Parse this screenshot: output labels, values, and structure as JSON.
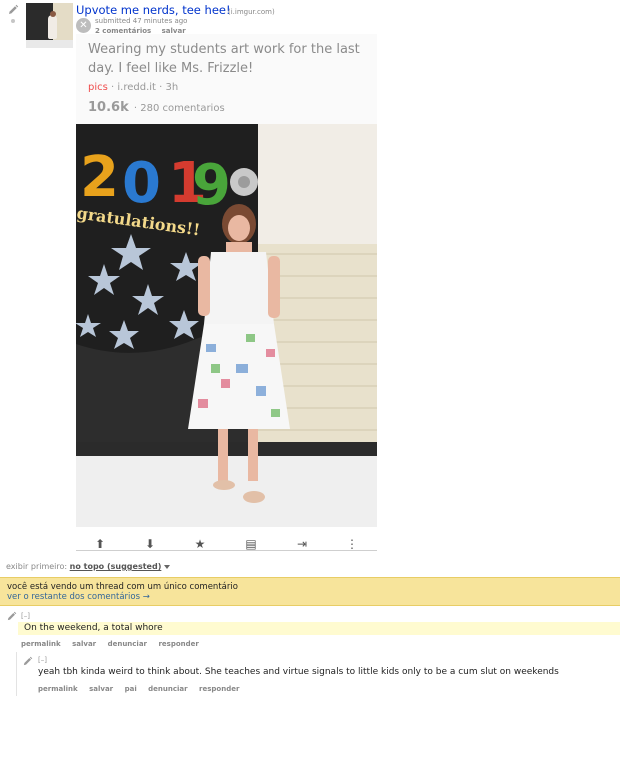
{
  "post": {
    "title": "Upvote me nerds, tee hee!",
    "domain": "(i.imgur.com)",
    "submitted": "submitted 47 minutes ago",
    "buttons": [
      "2 comentários",
      "salvar"
    ]
  },
  "embed": {
    "title": "Wearing my students art work for the last day. I feel like Ms. Frizzle!",
    "subreddit": "pics",
    "meta": "· i.redd.it · 3h",
    "score": "10.6k",
    "comments": "· 280 comentarios",
    "actions": [
      {
        "icon": "upvote-icon",
        "glyph": "⬆"
      },
      {
        "icon": "downvote-icon",
        "glyph": "⬇"
      },
      {
        "icon": "star-icon",
        "glyph": "★"
      },
      {
        "icon": "comment-icon",
        "glyph": "▤"
      },
      {
        "icon": "share-icon",
        "glyph": "⇥"
      },
      {
        "icon": "more-icon",
        "glyph": "⋮"
      }
    ],
    "photo_text": {
      "year_digits": [
        "2",
        "0",
        "1",
        "9"
      ],
      "banner": "gratulations!!"
    }
  },
  "sort": {
    "label": "exibir primeiro:",
    "selected": "no topo (suggested)"
  },
  "thread_notice": {
    "line1": "você está vendo um thread com um único comentário",
    "line2": "ver o restante dos comentários →"
  },
  "comments": [
    {
      "collapse": "[–]",
      "text": "On the weekend, a total whore",
      "actions": [
        "permalink",
        "salvar",
        "denunciar",
        "responder"
      ]
    },
    {
      "collapse": "[–]",
      "text": "yeah tbh kinda weird to think about. She teaches and virtue signals to little kids only to be a cum slut on weekends",
      "actions": [
        "permalink",
        "salvar",
        "pai",
        "denunciar",
        "responder"
      ]
    }
  ],
  "colors": {
    "link": "#0033cc",
    "subreddit": "#ef4d4d",
    "notice_bg": "#f7e49b",
    "comment_highlight": "#fffbd0"
  }
}
